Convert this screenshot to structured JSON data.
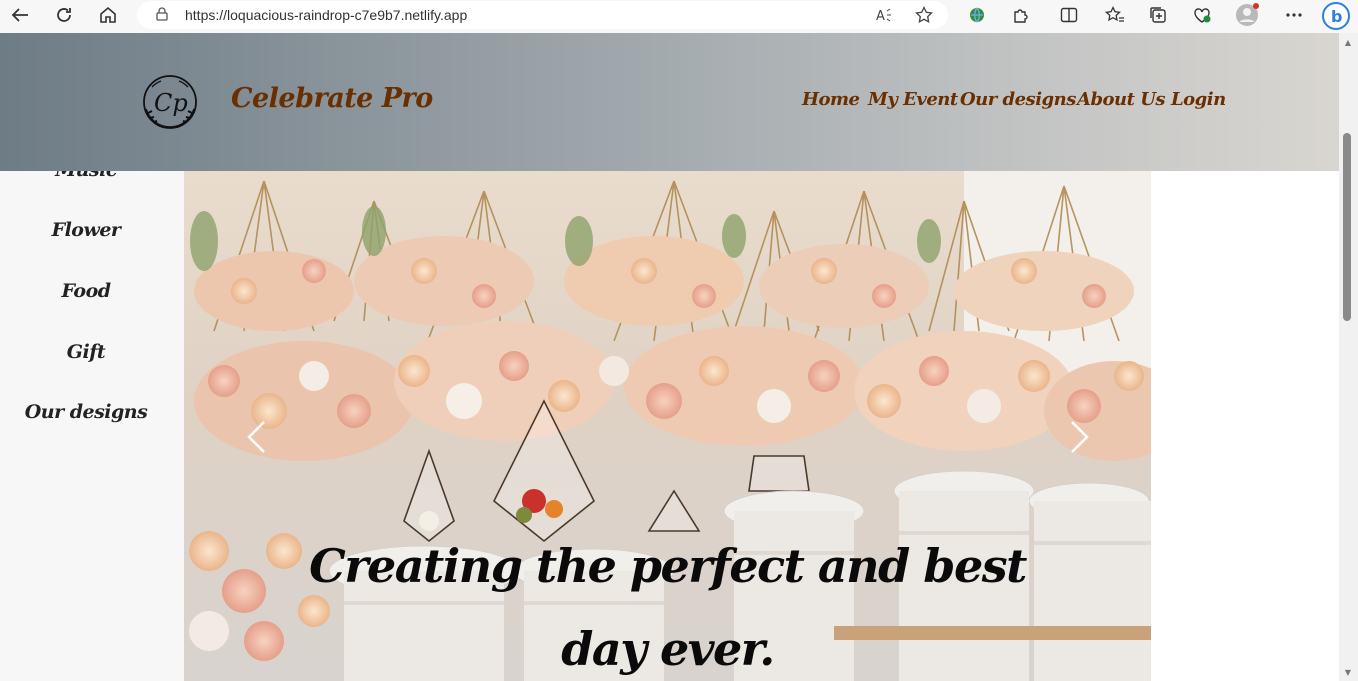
{
  "browser": {
    "url": "https://loquacious-raindrop-c7e9b7.netlify.app",
    "back_icon": "back-arrow-icon",
    "refresh_icon": "refresh-icon",
    "home_icon": "home-icon"
  },
  "header": {
    "brand": "Celebrate Pro",
    "logo_text": "Cp",
    "nav": [
      "Home",
      "My Event",
      "Our designs",
      "About Us",
      "Login"
    ]
  },
  "sidebar": {
    "items": [
      "Music",
      "Flower",
      "Food",
      "Gift",
      "Our designs"
    ]
  },
  "carousel": {
    "caption_line1": "Creating the perfect and best",
    "caption_line2": "day ever."
  },
  "colors": {
    "brand": "#6a2f00",
    "header_start": "#6e7c86",
    "header_end": "#d9d6d1",
    "sidebar_bg": "#f7f7f7"
  }
}
